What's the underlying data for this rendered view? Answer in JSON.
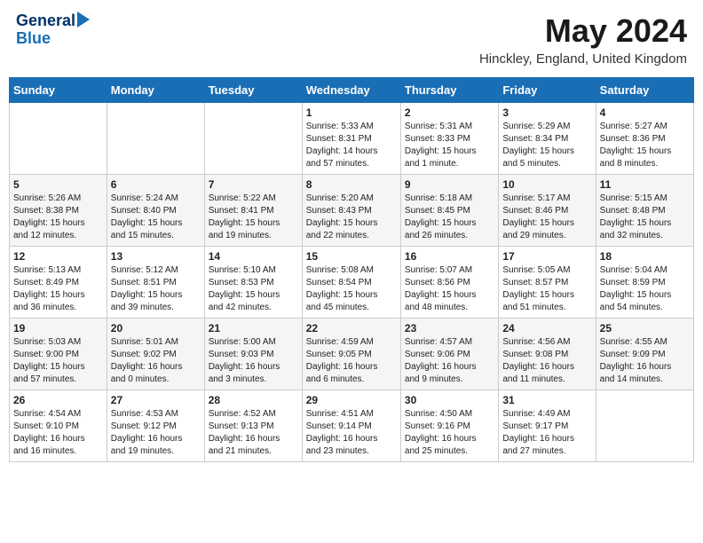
{
  "logo": {
    "line1": "General",
    "line2": "Blue"
  },
  "title": "May 2024",
  "location": "Hinckley, England, United Kingdom",
  "days_of_week": [
    "Sunday",
    "Monday",
    "Tuesday",
    "Wednesday",
    "Thursday",
    "Friday",
    "Saturday"
  ],
  "weeks": [
    [
      {
        "day": "",
        "info": ""
      },
      {
        "day": "",
        "info": ""
      },
      {
        "day": "",
        "info": ""
      },
      {
        "day": "1",
        "info": "Sunrise: 5:33 AM\nSunset: 8:31 PM\nDaylight: 14 hours\nand 57 minutes."
      },
      {
        "day": "2",
        "info": "Sunrise: 5:31 AM\nSunset: 8:33 PM\nDaylight: 15 hours\nand 1 minute."
      },
      {
        "day": "3",
        "info": "Sunrise: 5:29 AM\nSunset: 8:34 PM\nDaylight: 15 hours\nand 5 minutes."
      },
      {
        "day": "4",
        "info": "Sunrise: 5:27 AM\nSunset: 8:36 PM\nDaylight: 15 hours\nand 8 minutes."
      }
    ],
    [
      {
        "day": "5",
        "info": "Sunrise: 5:26 AM\nSunset: 8:38 PM\nDaylight: 15 hours\nand 12 minutes."
      },
      {
        "day": "6",
        "info": "Sunrise: 5:24 AM\nSunset: 8:40 PM\nDaylight: 15 hours\nand 15 minutes."
      },
      {
        "day": "7",
        "info": "Sunrise: 5:22 AM\nSunset: 8:41 PM\nDaylight: 15 hours\nand 19 minutes."
      },
      {
        "day": "8",
        "info": "Sunrise: 5:20 AM\nSunset: 8:43 PM\nDaylight: 15 hours\nand 22 minutes."
      },
      {
        "day": "9",
        "info": "Sunrise: 5:18 AM\nSunset: 8:45 PM\nDaylight: 15 hours\nand 26 minutes."
      },
      {
        "day": "10",
        "info": "Sunrise: 5:17 AM\nSunset: 8:46 PM\nDaylight: 15 hours\nand 29 minutes."
      },
      {
        "day": "11",
        "info": "Sunrise: 5:15 AM\nSunset: 8:48 PM\nDaylight: 15 hours\nand 32 minutes."
      }
    ],
    [
      {
        "day": "12",
        "info": "Sunrise: 5:13 AM\nSunset: 8:49 PM\nDaylight: 15 hours\nand 36 minutes."
      },
      {
        "day": "13",
        "info": "Sunrise: 5:12 AM\nSunset: 8:51 PM\nDaylight: 15 hours\nand 39 minutes."
      },
      {
        "day": "14",
        "info": "Sunrise: 5:10 AM\nSunset: 8:53 PM\nDaylight: 15 hours\nand 42 minutes."
      },
      {
        "day": "15",
        "info": "Sunrise: 5:08 AM\nSunset: 8:54 PM\nDaylight: 15 hours\nand 45 minutes."
      },
      {
        "day": "16",
        "info": "Sunrise: 5:07 AM\nSunset: 8:56 PM\nDaylight: 15 hours\nand 48 minutes."
      },
      {
        "day": "17",
        "info": "Sunrise: 5:05 AM\nSunset: 8:57 PM\nDaylight: 15 hours\nand 51 minutes."
      },
      {
        "day": "18",
        "info": "Sunrise: 5:04 AM\nSunset: 8:59 PM\nDaylight: 15 hours\nand 54 minutes."
      }
    ],
    [
      {
        "day": "19",
        "info": "Sunrise: 5:03 AM\nSunset: 9:00 PM\nDaylight: 15 hours\nand 57 minutes."
      },
      {
        "day": "20",
        "info": "Sunrise: 5:01 AM\nSunset: 9:02 PM\nDaylight: 16 hours\nand 0 minutes."
      },
      {
        "day": "21",
        "info": "Sunrise: 5:00 AM\nSunset: 9:03 PM\nDaylight: 16 hours\nand 3 minutes."
      },
      {
        "day": "22",
        "info": "Sunrise: 4:59 AM\nSunset: 9:05 PM\nDaylight: 16 hours\nand 6 minutes."
      },
      {
        "day": "23",
        "info": "Sunrise: 4:57 AM\nSunset: 9:06 PM\nDaylight: 16 hours\nand 9 minutes."
      },
      {
        "day": "24",
        "info": "Sunrise: 4:56 AM\nSunset: 9:08 PM\nDaylight: 16 hours\nand 11 minutes."
      },
      {
        "day": "25",
        "info": "Sunrise: 4:55 AM\nSunset: 9:09 PM\nDaylight: 16 hours\nand 14 minutes."
      }
    ],
    [
      {
        "day": "26",
        "info": "Sunrise: 4:54 AM\nSunset: 9:10 PM\nDaylight: 16 hours\nand 16 minutes."
      },
      {
        "day": "27",
        "info": "Sunrise: 4:53 AM\nSunset: 9:12 PM\nDaylight: 16 hours\nand 19 minutes."
      },
      {
        "day": "28",
        "info": "Sunrise: 4:52 AM\nSunset: 9:13 PM\nDaylight: 16 hours\nand 21 minutes."
      },
      {
        "day": "29",
        "info": "Sunrise: 4:51 AM\nSunset: 9:14 PM\nDaylight: 16 hours\nand 23 minutes."
      },
      {
        "day": "30",
        "info": "Sunrise: 4:50 AM\nSunset: 9:16 PM\nDaylight: 16 hours\nand 25 minutes."
      },
      {
        "day": "31",
        "info": "Sunrise: 4:49 AM\nSunset: 9:17 PM\nDaylight: 16 hours\nand 27 minutes."
      },
      {
        "day": "",
        "info": ""
      }
    ]
  ]
}
